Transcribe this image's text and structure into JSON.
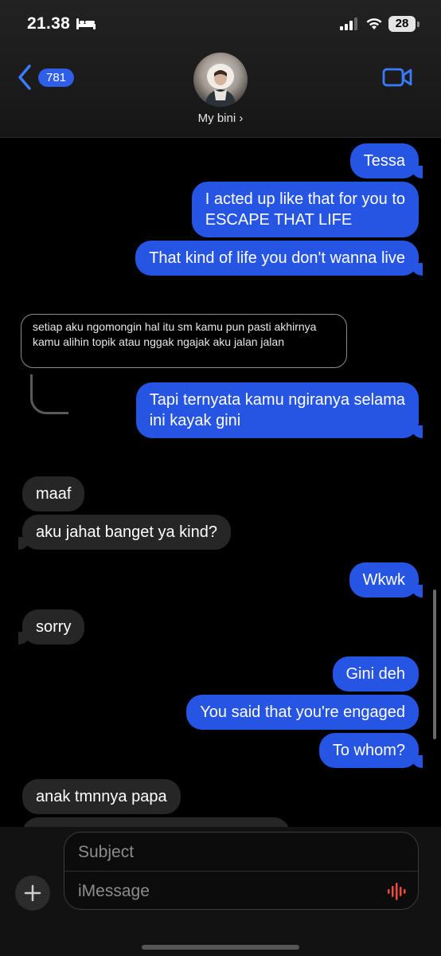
{
  "status_bar": {
    "time": "21.38",
    "battery": "28"
  },
  "header": {
    "back_count": "781",
    "contact_name": "My bini ›"
  },
  "reply": {
    "quoted_text": "setiap aku ngomongin hal itu sm kamu pun pasti akhirnya kamu alihin topik atau nggak ngajak aku jalan jalan"
  },
  "messages": [
    {
      "from": "me",
      "text": "Tessa"
    },
    {
      "from": "me",
      "text": "I acted up like that for you to\nESCAPE THAT LIFE"
    },
    {
      "from": "me",
      "text": "That kind of life you don't wanna live"
    },
    {
      "from": "me",
      "text": "Tapi ternyata kamu ngiranya selama\nini kayak gini"
    },
    {
      "from": "them",
      "text": "maaf"
    },
    {
      "from": "them",
      "text": "aku jahat banget ya kind?"
    },
    {
      "from": "me",
      "text": "Wkwk"
    },
    {
      "from": "them",
      "text": "sorry"
    },
    {
      "from": "me",
      "text": "Gini deh"
    },
    {
      "from": "me",
      "text": "You said that you're engaged"
    },
    {
      "from": "me",
      "text": "To whom?"
    },
    {
      "from": "them",
      "text": "anak tmnnya papa"
    }
  ],
  "composer": {
    "subject_placeholder": "Subject",
    "message_placeholder": "iMessage"
  },
  "colors": {
    "outgoing_bubble": "#2755e3",
    "incoming_bubble": "#262626",
    "background": "#000000"
  },
  "icons": [
    "bed-icon",
    "signal-icon",
    "wifi-icon",
    "back-chevron-icon",
    "video-call-icon",
    "plus-icon",
    "audio-wave-icon"
  ]
}
